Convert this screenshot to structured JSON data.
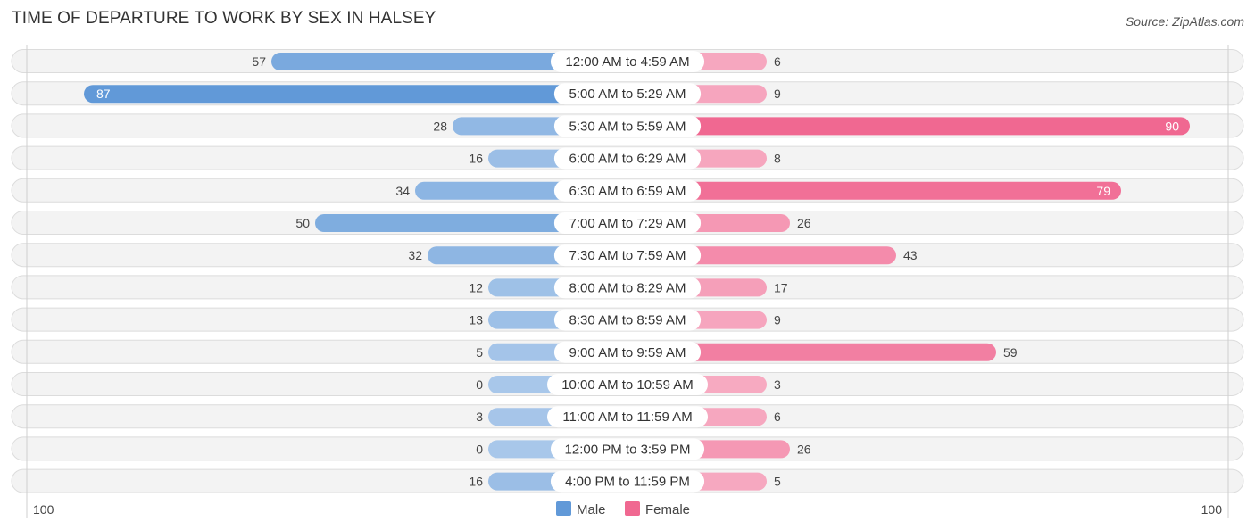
{
  "chart_data": {
    "type": "bar",
    "orientation": "horizontal-diverging",
    "title": "TIME OF DEPARTURE TO WORK BY SEX IN HALSEY",
    "source": "Source: ZipAtlas.com",
    "categories": [
      "12:00 AM to 4:59 AM",
      "5:00 AM to 5:29 AM",
      "5:30 AM to 5:59 AM",
      "6:00 AM to 6:29 AM",
      "6:30 AM to 6:59 AM",
      "7:00 AM to 7:29 AM",
      "7:30 AM to 7:59 AM",
      "8:00 AM to 8:29 AM",
      "8:30 AM to 8:59 AM",
      "9:00 AM to 9:59 AM",
      "10:00 AM to 10:59 AM",
      "11:00 AM to 11:59 AM",
      "12:00 PM to 3:59 PM",
      "4:00 PM to 11:59 PM"
    ],
    "series": [
      {
        "name": "Male",
        "color": "#6199d8",
        "values": [
          57,
          87,
          28,
          16,
          34,
          50,
          32,
          12,
          13,
          5,
          0,
          3,
          0,
          16
        ]
      },
      {
        "name": "Female",
        "color": "#f06891",
        "values": [
          6,
          9,
          90,
          8,
          79,
          26,
          43,
          17,
          9,
          59,
          3,
          6,
          26,
          5
        ]
      }
    ],
    "axis": {
      "left_label": "100",
      "right_label": "100",
      "xlim": [
        -100,
        100
      ]
    },
    "legend": {
      "position": "bottom-center",
      "items": [
        "Male",
        "Female"
      ]
    },
    "grid": false
  }
}
